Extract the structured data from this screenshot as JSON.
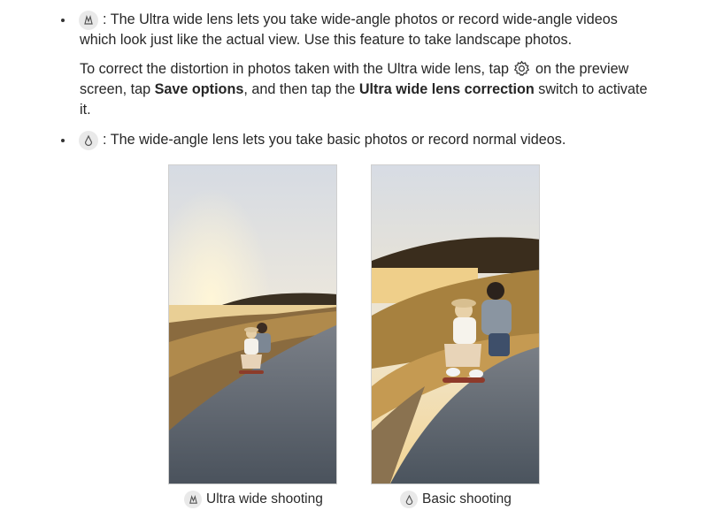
{
  "bullets": [
    {
      "icon": "ultra-wide-lens-icon",
      "line1": ": The Ultra wide lens lets you take wide-angle photos or record wide-angle videos",
      "line2": "which look just like the actual view. Use this feature to take landscape photos."
    },
    {
      "icon": "wide-lens-icon",
      "text": ": The wide-angle lens lets you take basic photos or record normal videos."
    }
  ],
  "note": {
    "line1_before": "To correct the distortion in photos taken with the Ultra wide lens, tap ",
    "line1_after": " on the preview",
    "line2_before": "screen, tap ",
    "save_options": "Save options",
    "line2_middle": ", and then tap the ",
    "ultra_wide_correction": "Ultra wide lens correction",
    "line2_after": " switch to activate",
    "line3": "it.",
    "gear_icon": "settings-gear-icon"
  },
  "photos": [
    {
      "caption": "Ultra wide shooting",
      "caption_icon": "ultra-wide-lens-icon"
    },
    {
      "caption": "Basic shooting",
      "caption_icon": "wide-lens-icon"
    }
  ],
  "colors": {
    "text": "#262626",
    "icon_bg": "#e9e9e9",
    "sky_top": "#d9dee6",
    "sky_glow": "#f6e7c4",
    "road": "#4f5963"
  }
}
